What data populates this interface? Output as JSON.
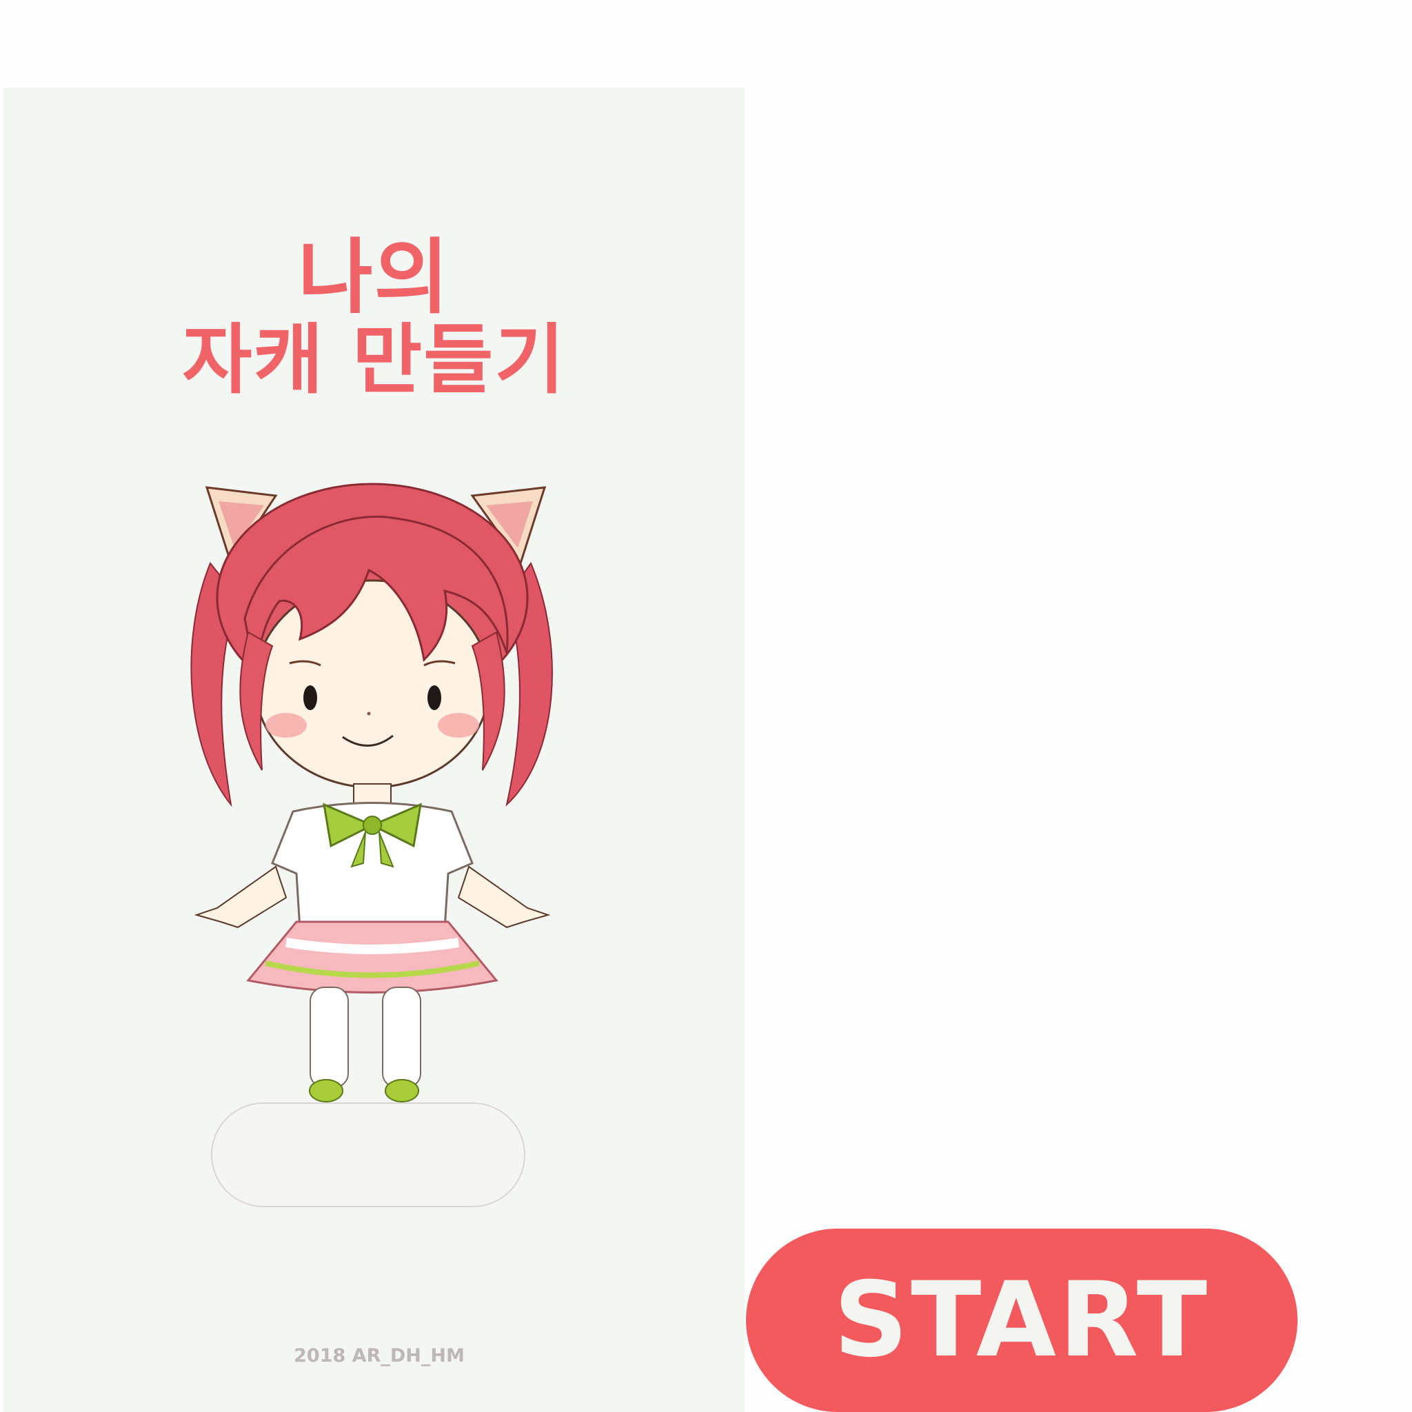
{
  "title": {
    "line1": "나의",
    "line2": "자캐 만들기"
  },
  "name_input": {
    "value": "",
    "placeholder": ""
  },
  "copyright": "2018 AR_DH_HM",
  "start_button": {
    "label": "START"
  },
  "character": {
    "icon": "chibi-catgirl-illustration"
  },
  "colors": {
    "accent": "#f25a5e",
    "title": "#f06468",
    "panel_background": "#f4f6f3",
    "hair": "#e05866",
    "bow": "#9bc735"
  }
}
